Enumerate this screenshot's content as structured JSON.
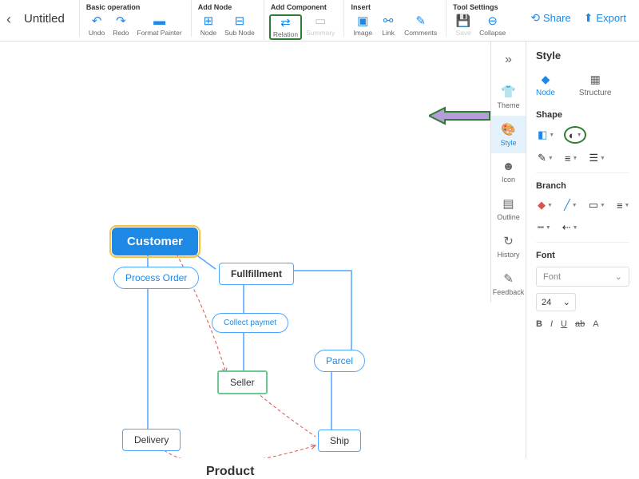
{
  "doc": {
    "title": "Untitled"
  },
  "toolbar": {
    "groups": {
      "basic": {
        "label": "Basic operation",
        "undo": "Undo",
        "redo": "Redo",
        "format": "Format Painter"
      },
      "addNode": {
        "label": "Add Node",
        "node": "Node",
        "subNode": "Sub Node"
      },
      "addComponent": {
        "label": "Add Component",
        "relation": "Relation",
        "summary": "Summary"
      },
      "insert": {
        "label": "Insert",
        "image": "Image",
        "link": "Link",
        "comments": "Comments"
      },
      "toolSettings": {
        "label": "Tool Settings",
        "save": "Save",
        "collapse": "Collapse"
      }
    },
    "share": "Share",
    "export": "Export"
  },
  "sidetabs": {
    "theme": "Theme",
    "style": "Style",
    "icon": "Icon",
    "outline": "Outline",
    "history": "History",
    "feedback": "Feedback"
  },
  "panel": {
    "title": "Style",
    "nodeTab": "Node",
    "structureTab": "Structure",
    "shape": "Shape",
    "branch": "Branch",
    "font": "Font",
    "fontPlaceholder": "Font",
    "fontSize": "24",
    "bold": "B",
    "italic": "I",
    "underline": "U",
    "ab": "ab",
    "colorA": "A"
  },
  "canvas": {
    "customer": "Customer",
    "processOrder": "Process Order",
    "fullfillment": "Fullfillment",
    "collectPaymet": "Collect paymet",
    "seller": "Seller",
    "parcel": "Parcel",
    "delivery": "Delivery",
    "ship": "Ship",
    "product": "Product"
  }
}
